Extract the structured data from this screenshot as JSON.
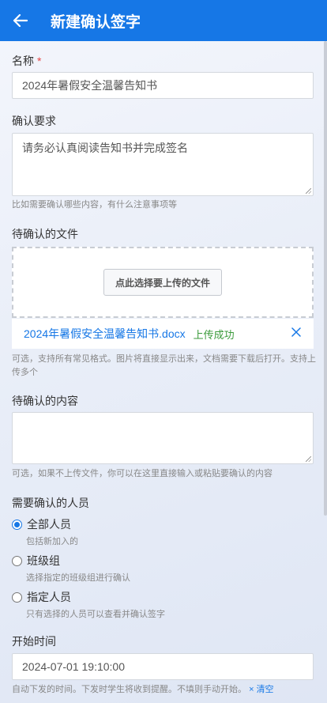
{
  "header": {
    "title": "新建确认签字"
  },
  "name_field": {
    "label": "名称",
    "required_mark": "*",
    "value": "2024年暑假安全温馨告知书"
  },
  "requirement_field": {
    "label": "确认要求",
    "value": "请务必认真阅读告知书并完成签名",
    "hint": "比如需要确认哪些内容，有什么注意事项等"
  },
  "files_field": {
    "label": "待确认的文件",
    "upload_button": "点此选择要上传的文件",
    "file": {
      "name": "2024年暑假安全温馨告知书.docx",
      "status": "上传成功"
    },
    "hint": "可选，支持所有常见格式。图片将直接显示出来，文档需要下载后打开。支持上传多个"
  },
  "content_field": {
    "label": "待确认的内容",
    "value": "",
    "hint": "可选，如果不上传文件，你可以在这里直接输入或粘贴要确认的内容"
  },
  "people_field": {
    "label": "需要确认的人员",
    "options": [
      {
        "label": "全部人员",
        "desc": "包括新加入的",
        "checked": true
      },
      {
        "label": "班级组",
        "desc": "选择指定的班级组进行确认",
        "checked": false
      },
      {
        "label": "指定人员",
        "desc": "只有选择的人员可以查看并确认签字",
        "checked": false
      }
    ]
  },
  "start_time_field": {
    "label": "开始时间",
    "value": "2024-07-01 19:10:00",
    "hint": "自动下发的时间。下发时学生将收到提醒。不填则手动开始。",
    "clear_icon": "×",
    "clear_label": "清空"
  },
  "icons": {
    "back": "arrow-left-icon",
    "remove": "close-icon"
  },
  "colors": {
    "primary": "#1677e6",
    "success": "#3a9a3a",
    "required": "#e54545"
  }
}
